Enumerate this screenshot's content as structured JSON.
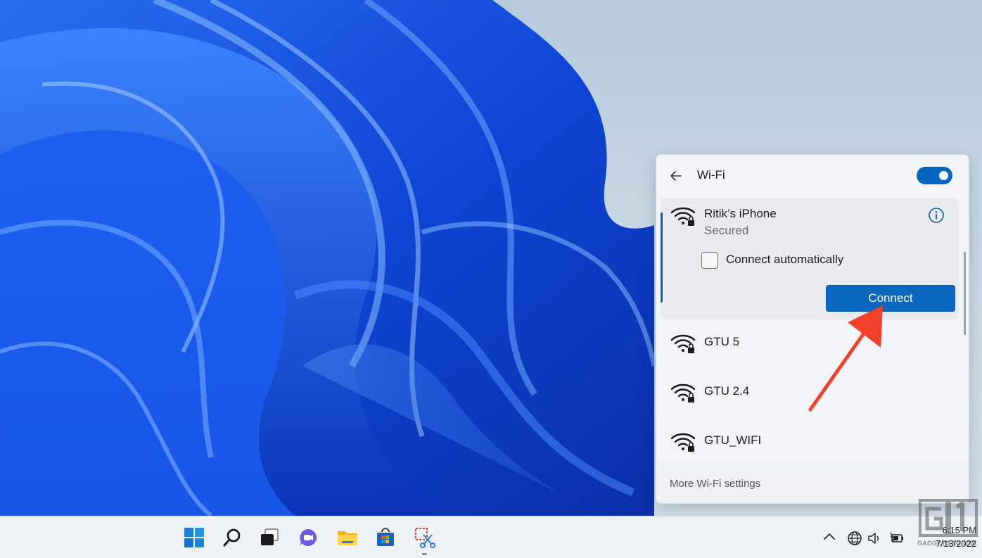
{
  "wifi_panel": {
    "title": "Wi-Fi",
    "toggle_state": "on",
    "expanded_network": {
      "name": "Ritik’s iPhone",
      "status": "Secured",
      "connect_automatically_label": "Connect automatically",
      "connect_automatically_checked": false,
      "connect_button": "Connect"
    },
    "networks": [
      {
        "name": "GTU 5"
      },
      {
        "name": "GTU 2.4"
      },
      {
        "name": "GTU_WIFI"
      }
    ],
    "footer_link": "More Wi-Fi settings"
  },
  "taskbar": {
    "icons": [
      "windows-start-icon",
      "search-icon",
      "task-view-icon",
      "chat-icon",
      "file-explorer-icon",
      "store-icon",
      "snipping-tool-icon"
    ],
    "tray_icons": [
      "chevron-up-icon",
      "globe-icon",
      "volume-icon",
      "battery-icon"
    ],
    "clock": {
      "time": "6:15 PM",
      "date": "7/13/2022"
    }
  },
  "watermark": {
    "text": "GADGETS TO USE"
  },
  "colors": {
    "accent": "#0067c0",
    "arrow": "#f0412a"
  }
}
